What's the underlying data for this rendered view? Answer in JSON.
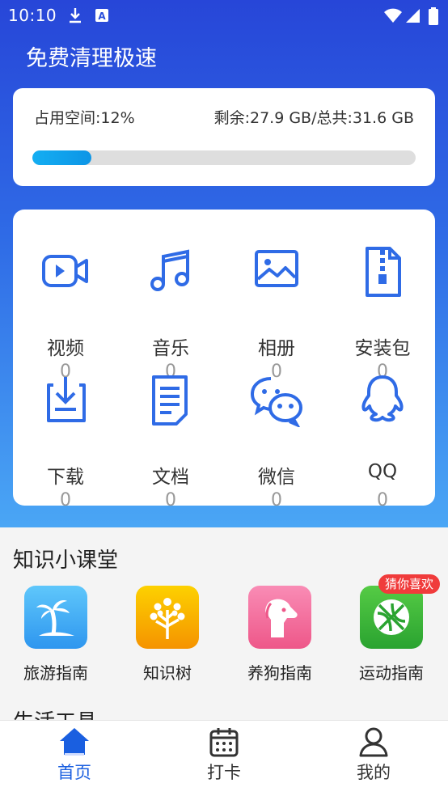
{
  "status_bar": {
    "time": "10:10"
  },
  "header": {
    "title": "免费清理极速"
  },
  "storage": {
    "used_label": "占用空间:12%",
    "remain_label": "剩余:27.9 GB/总共:31.6 GB",
    "used_fraction": 0.155
  },
  "categories": [
    {
      "label": "视频",
      "count": "0",
      "icon": "video-icon"
    },
    {
      "label": "音乐",
      "count": "0",
      "icon": "music-icon"
    },
    {
      "label": "相册",
      "count": "0",
      "icon": "image-icon"
    },
    {
      "label": "安装包",
      "count": "0",
      "icon": "zip-icon"
    },
    {
      "label": "下载",
      "count": "0",
      "icon": "download-icon"
    },
    {
      "label": "文档",
      "count": "0",
      "icon": "document-icon"
    },
    {
      "label": "微信",
      "count": "0",
      "icon": "wechat-icon"
    },
    {
      "label": "QQ",
      "count": "0",
      "icon": "qq-icon"
    }
  ],
  "knowledge": {
    "title": "知识小课堂",
    "badge": "猜你喜欢",
    "items": [
      {
        "label": "旅游指南",
        "icon": "palm-island-icon",
        "color": "#3aa7f3"
      },
      {
        "label": "知识树",
        "icon": "tree-icon",
        "color": "#f7a600"
      },
      {
        "label": "养狗指南",
        "icon": "dog-icon",
        "color": "#f26d9a"
      },
      {
        "label": "运动指南",
        "icon": "basketball-icon",
        "color": "#3bb53b"
      }
    ]
  },
  "section2": {
    "title": "生活工具"
  },
  "tabs": [
    {
      "label": "首页",
      "icon": "home-icon",
      "active": true
    },
    {
      "label": "打卡",
      "icon": "calendar-icon",
      "active": false
    },
    {
      "label": "我的",
      "icon": "user-icon",
      "active": false
    }
  ],
  "colors": {
    "accent": "#1a5fe0",
    "icon_blue": "#2f6be6",
    "tab_inactive": "#333333"
  }
}
